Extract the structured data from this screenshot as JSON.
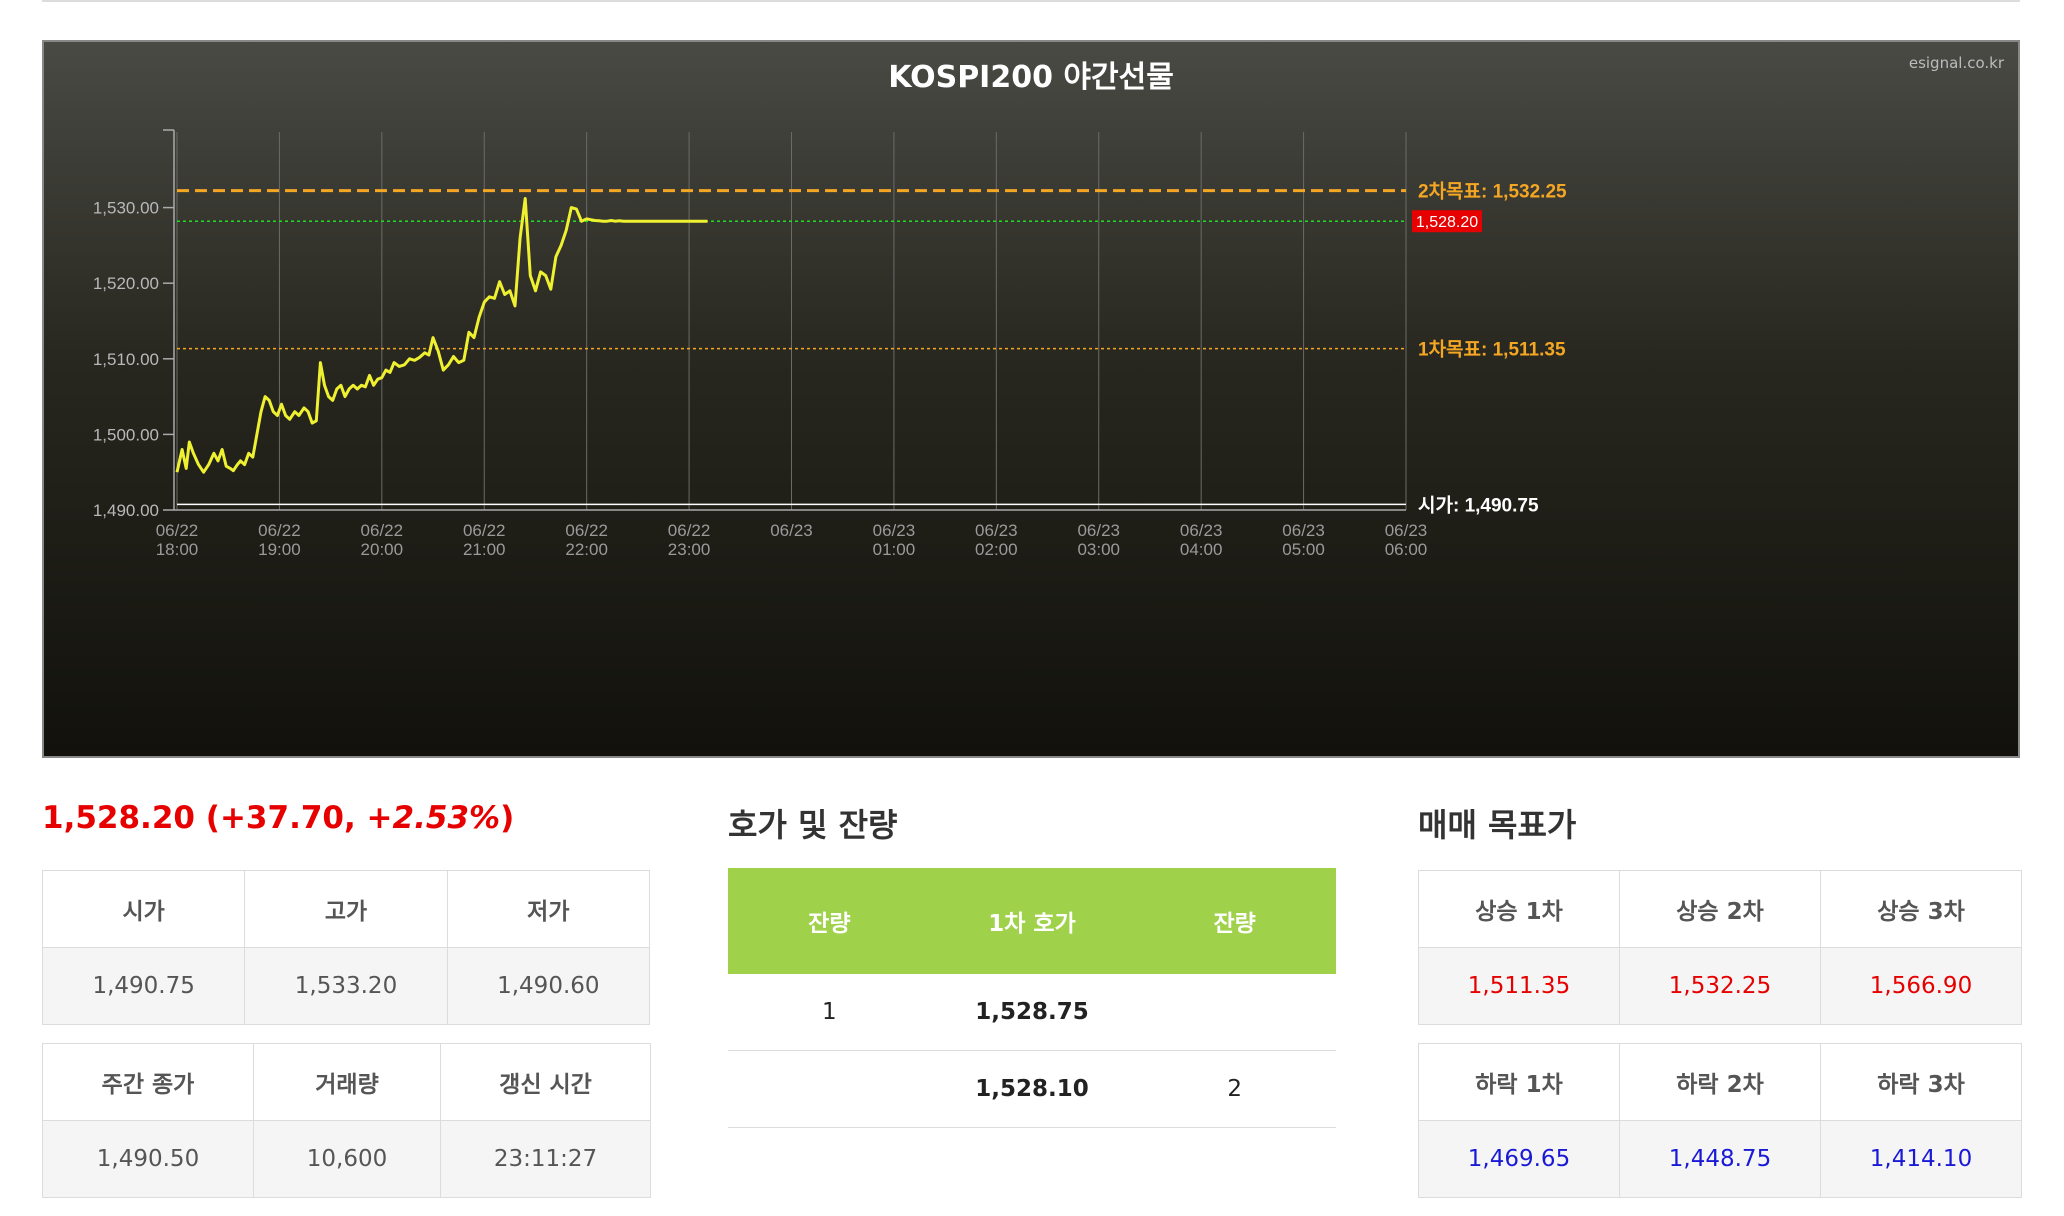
{
  "chart": {
    "title": "KOSPI200 야간선물",
    "credit": "esignal.co.kr",
    "current_price_label": "1,528.20"
  },
  "chart_data": {
    "type": "line",
    "title": "KOSPI200 야간선물",
    "x_unit": "hours since 06/22 18:00",
    "xlim": [
      0,
      12
    ],
    "ylim": [
      1490,
      1540
    ],
    "y_ticks": [
      {
        "value": 1490,
        "label": "1,490.00"
      },
      {
        "value": 1500,
        "label": "1,500.00"
      },
      {
        "value": 1510,
        "label": "1,510.00"
      },
      {
        "value": 1520,
        "label": "1,520.00"
      },
      {
        "value": 1530,
        "label": "1,530.00"
      }
    ],
    "x_ticks": [
      {
        "date": "06/22",
        "time": "18:00"
      },
      {
        "date": "06/22",
        "time": "19:00"
      },
      {
        "date": "06/22",
        "time": "20:00"
      },
      {
        "date": "06/22",
        "time": "21:00"
      },
      {
        "date": "06/22",
        "time": "22:00"
      },
      {
        "date": "06/22",
        "time": "23:00"
      },
      {
        "date": "06/23",
        "time": ""
      },
      {
        "date": "06/23",
        "time": "01:00"
      },
      {
        "date": "06/23",
        "time": "02:00"
      },
      {
        "date": "06/23",
        "time": "03:00"
      },
      {
        "date": "06/23",
        "time": "04:00"
      },
      {
        "date": "06/23",
        "time": "05:00"
      },
      {
        "date": "06/23",
        "time": "06:00"
      }
    ],
    "reference_lines": [
      {
        "label": "2차목표: 1,532.25",
        "value": 1532.25,
        "color": "#f5a623",
        "style": "dashed"
      },
      {
        "label": "1차목표: 1,511.35",
        "value": 1511.35,
        "color": "#f5a623",
        "style": "dotted"
      },
      {
        "label": "시가: 1,490.75",
        "value": 1490.75,
        "color": "#ffffff",
        "style": "solid"
      },
      {
        "label": "",
        "value": 1528.2,
        "color": "#22dd22",
        "style": "dotted"
      }
    ],
    "series": [
      {
        "color": "#eef030",
        "x": [
          0.0,
          0.05,
          0.09,
          0.12,
          0.16,
          0.21,
          0.26,
          0.31,
          0.36,
          0.4,
          0.44,
          0.48,
          0.52,
          0.55,
          0.59,
          0.62,
          0.66,
          0.7,
          0.74,
          0.78,
          0.82,
          0.86,
          0.9,
          0.94,
          0.98,
          1.02,
          1.06,
          1.1,
          1.15,
          1.19,
          1.24,
          1.28,
          1.32,
          1.36,
          1.4,
          1.44,
          1.48,
          1.52,
          1.56,
          1.6,
          1.64,
          1.68,
          1.72,
          1.76,
          1.8,
          1.84,
          1.88,
          1.92,
          1.96,
          2.0,
          2.04,
          2.08,
          2.12,
          2.17,
          2.22,
          2.27,
          2.32,
          2.37,
          2.42,
          2.46,
          2.5,
          2.55,
          2.6,
          2.65,
          2.7,
          2.75,
          2.8,
          2.85,
          2.9,
          2.95,
          3.0,
          3.05,
          3.1,
          3.15,
          3.2,
          3.25,
          3.3,
          3.35,
          3.4,
          3.45,
          3.5,
          3.55,
          3.6,
          3.65,
          3.7,
          3.75,
          3.8,
          3.85,
          3.9,
          3.95,
          4.0,
          4.04,
          4.08,
          4.12,
          4.16,
          4.2,
          4.24,
          4.28,
          4.32,
          4.36,
          4.4,
          4.44,
          4.48,
          4.52,
          4.56,
          4.58,
          4.6,
          4.62,
          4.64,
          4.66,
          4.68,
          4.7,
          4.72,
          4.76,
          4.8,
          4.84,
          4.88,
          4.92,
          4.96,
          5.0,
          5.04,
          5.08,
          5.12,
          5.16,
          5.18
        ],
        "y": [
          1495,
          1498,
          1495.5,
          1499,
          1497.5,
          1496,
          1495,
          1496,
          1497.5,
          1496.5,
          1498,
          1495.8,
          1495.5,
          1495.2,
          1496,
          1496.5,
          1496,
          1497.5,
          1497,
          1500,
          1503,
          1505,
          1504.5,
          1503,
          1502.5,
          1504,
          1502.5,
          1502,
          1503,
          1502.5,
          1503.5,
          1503,
          1501.5,
          1501.8,
          1509.5,
          1506.5,
          1505,
          1504.5,
          1506,
          1506.5,
          1505,
          1506,
          1506.5,
          1506,
          1506.5,
          1506.3,
          1507.8,
          1506.5,
          1507.3,
          1507.5,
          1508.5,
          1508.2,
          1509.5,
          1509,
          1509.2,
          1510,
          1509.8,
          1510.2,
          1510.8,
          1510.5,
          1512.8,
          1511,
          1508.5,
          1509.2,
          1510.3,
          1509.5,
          1509.8,
          1513.5,
          1512.8,
          1515.5,
          1517.5,
          1518.2,
          1518,
          1520.2,
          1518.5,
          1519,
          1517,
          1526,
          1531.2,
          1521,
          1519,
          1521.5,
          1521,
          1519.2,
          1523.5,
          1525,
          1527,
          1530,
          1529.8,
          1528.2,
          1528.5,
          1528.4,
          1528.3,
          1528.25,
          1528.2,
          1528.2,
          1528.3,
          1528.2,
          1528.25,
          1528.2,
          1528.2,
          1528.2,
          1528.2,
          1528.2,
          1528.2,
          1528.2,
          1528.2,
          1528.2,
          1528.2,
          1528.2,
          1528.2,
          1528.2,
          1528.2,
          1528.2,
          1528.2,
          1528.2,
          1528.2,
          1528.2,
          1528.2,
          1528.2,
          1528.2,
          1528.2,
          1528.2,
          1528.2,
          1528.2
        ]
      }
    ],
    "grid": true
  },
  "summary": {
    "headline_price": "1,528.20",
    "headline_change": "(+37.70, +",
    "headline_pct": "2.53%",
    "headline_close": ")",
    "table1": {
      "headers": [
        "시가",
        "고가",
        "저가"
      ],
      "values": [
        "1,490.75",
        "1,533.20",
        "1,490.60"
      ]
    },
    "table2": {
      "headers": [
        "주간 종가",
        "거래량",
        "갱신 시간"
      ],
      "values": [
        "1,490.50",
        "10,600",
        "23:11:27"
      ]
    }
  },
  "orderbook": {
    "title": "호가 및 잔량",
    "headers": [
      "잔량",
      "1차 호가",
      "잔량"
    ],
    "rows": [
      [
        "1",
        "1,528.75",
        ""
      ],
      [
        "",
        "1,528.10",
        "2"
      ]
    ]
  },
  "targets": {
    "title": "매매 목표가",
    "up_headers": [
      "상승 1차",
      "상승 2차",
      "상승 3차"
    ],
    "up_values": [
      "1,511.35",
      "1,532.25",
      "1,566.90"
    ],
    "down_headers": [
      "하락 1차",
      "하락 2차",
      "하락 3차"
    ],
    "down_values": [
      "1,469.65",
      "1,448.75",
      "1,414.10"
    ]
  }
}
